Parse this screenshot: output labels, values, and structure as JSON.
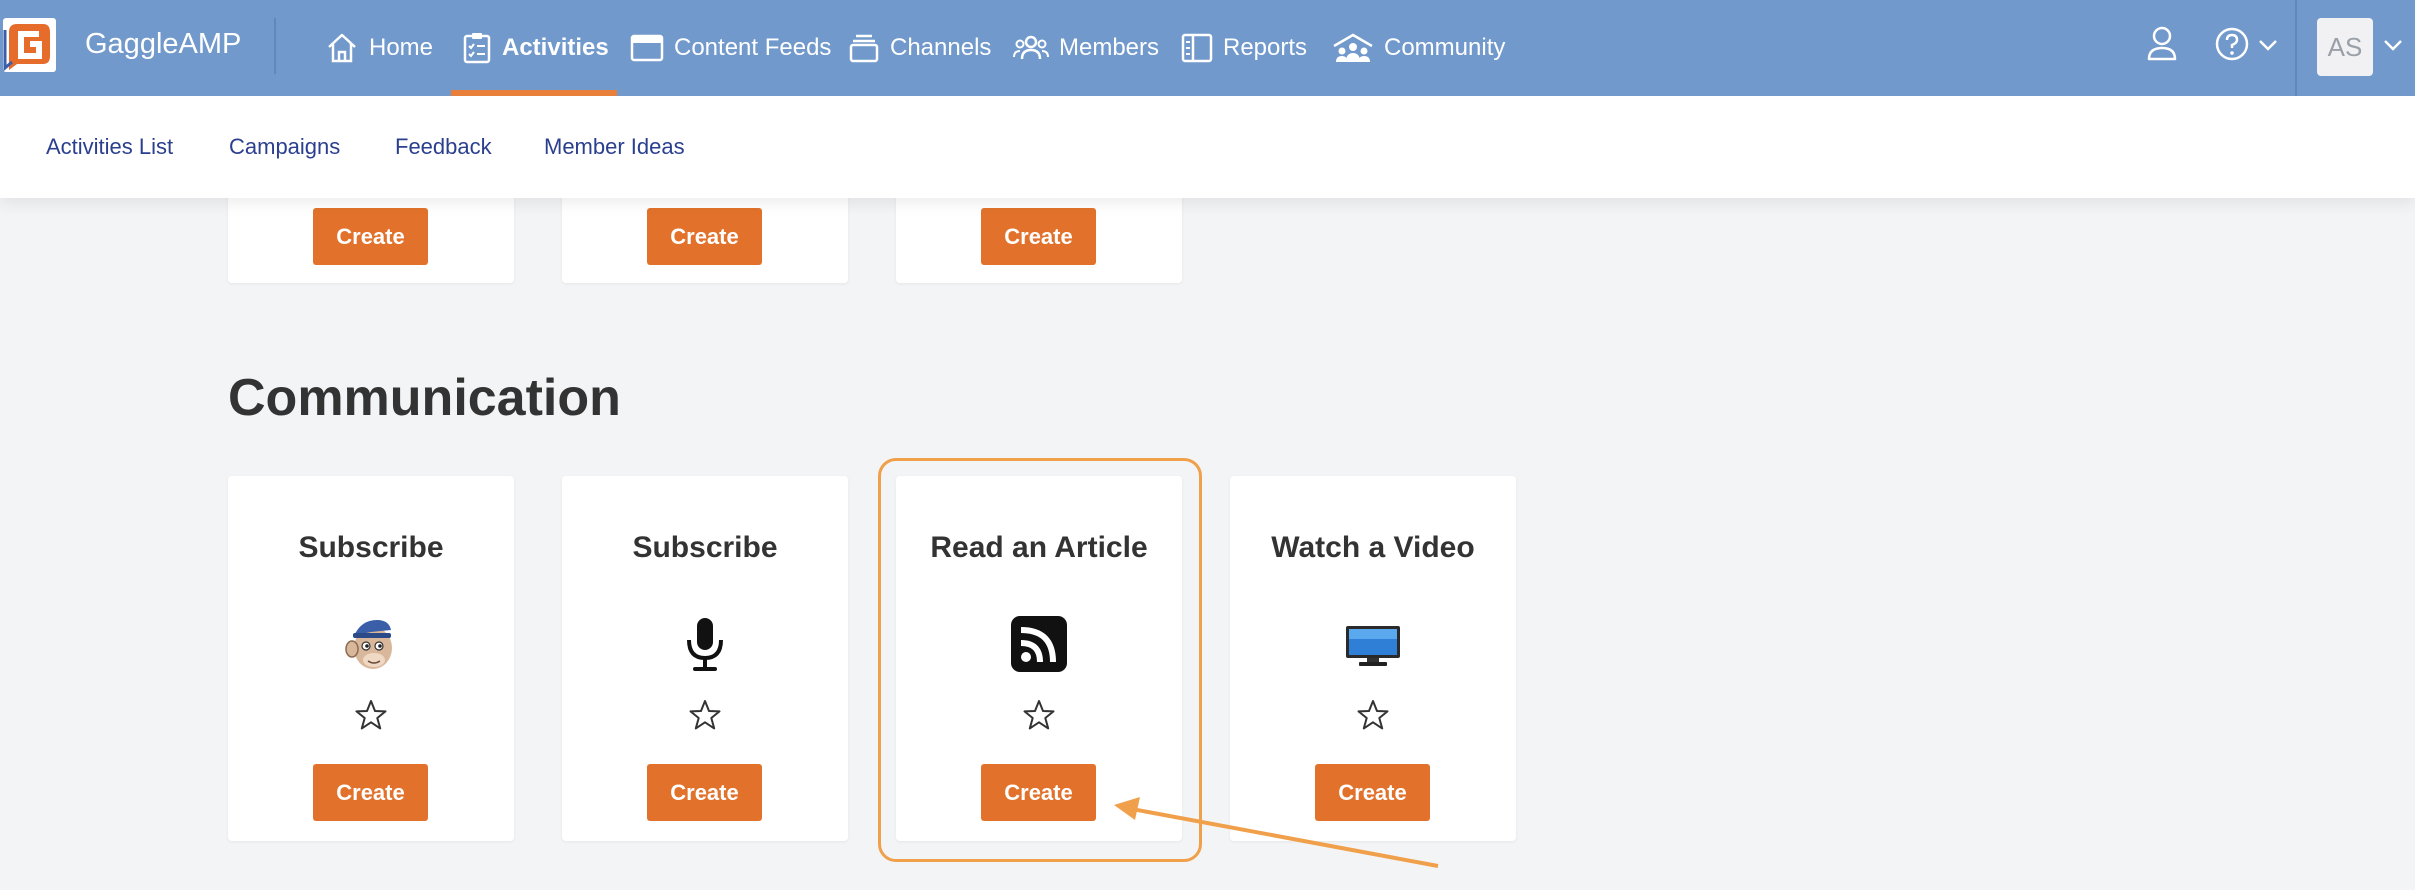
{
  "app": {
    "brand": "GaggleAMP",
    "avatar_initials": "AS"
  },
  "nav": {
    "items": [
      {
        "label": "Home",
        "icon": "home-icon"
      },
      {
        "label": "Activities",
        "icon": "clipboard-check-icon",
        "active": true
      },
      {
        "label": "Content Feeds",
        "icon": "window-icon"
      },
      {
        "label": "Channels",
        "icon": "stack-icon"
      },
      {
        "label": "Members",
        "icon": "users-icon"
      },
      {
        "label": "Reports",
        "icon": "columns-icon"
      },
      {
        "label": "Community",
        "icon": "community-icon"
      }
    ]
  },
  "subnav": {
    "items": [
      "Activities List",
      "Campaigns",
      "Feedback",
      "Member Ideas"
    ]
  },
  "top_cards": [
    {
      "button": "Create"
    },
    {
      "button": "Create"
    },
    {
      "button": "Create"
    }
  ],
  "section": {
    "title": "Communication"
  },
  "cards": [
    {
      "title": "Subscribe",
      "icon": "mailchimp-icon",
      "button": "Create"
    },
    {
      "title": "Subscribe",
      "icon": "microphone-icon",
      "button": "Create"
    },
    {
      "title": "Read an Article",
      "icon": "rss-icon",
      "button": "Create",
      "highlighted": true
    },
    {
      "title": "Watch a Video",
      "icon": "monitor-icon",
      "button": "Create"
    }
  ],
  "colors": {
    "topbar": "#7199cb",
    "accent": "#e2722b",
    "highlight": "#f0a04b",
    "subnav_link": "#2b3f8f"
  }
}
